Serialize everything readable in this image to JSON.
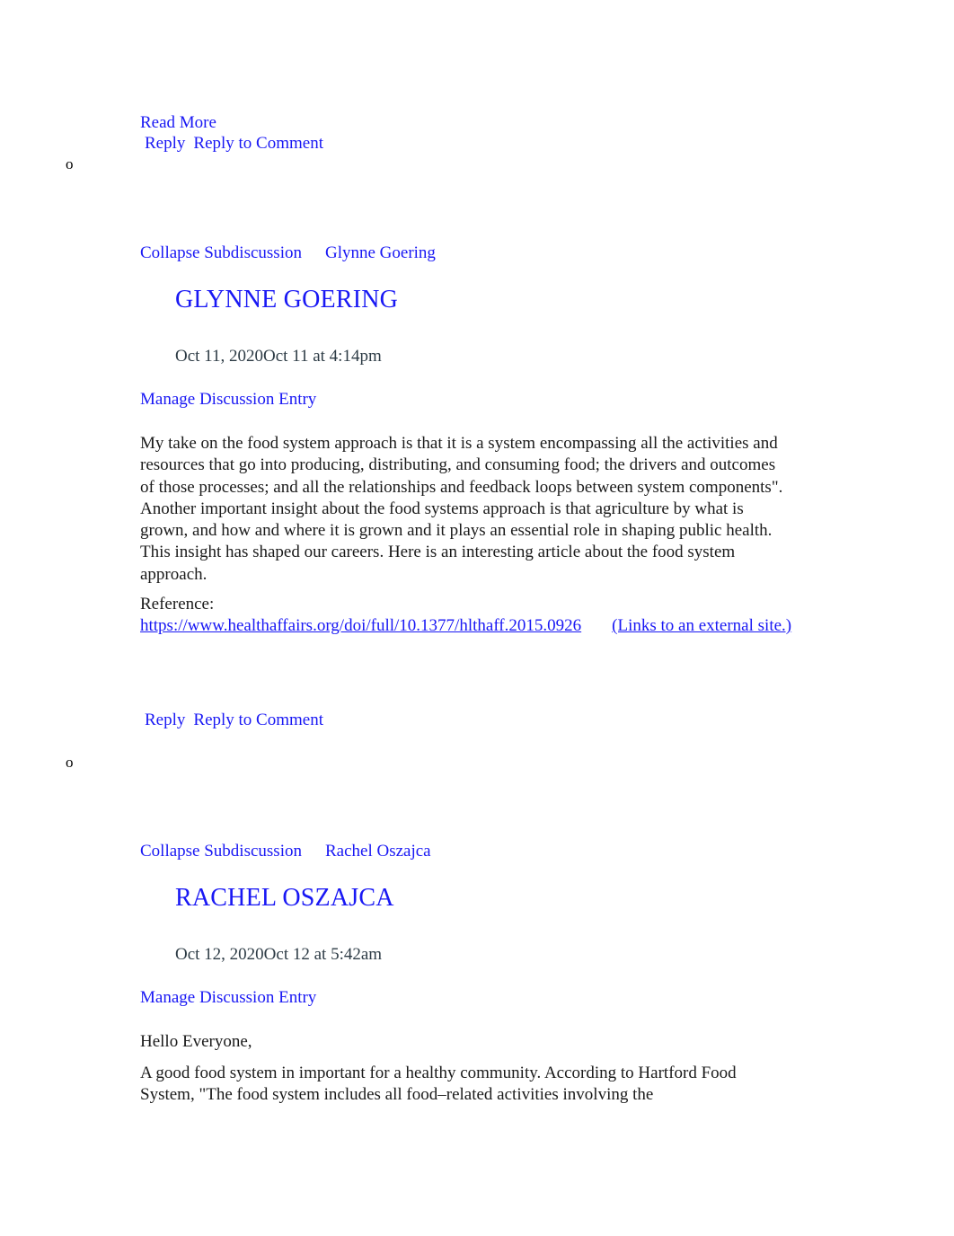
{
  "document": {
    "type": "canvas-discussion-thread",
    "colors": {
      "link": "#1918F4",
      "body_text": "#1a1a1a",
      "date_text": "#2D3B45",
      "background": "#ffffff"
    }
  },
  "top_entry_actions": {
    "read_more_label": "Read More",
    "reply_label": "Reply",
    "reply_to_comment_label": "Reply to Comment"
  },
  "bullets": {
    "first": "o",
    "second": "o"
  },
  "entries": [
    {
      "collapse_label": "Collapse Subdiscussion",
      "collapse_author": "Glynne Goering",
      "author_heading": "GLYNNE GOERING",
      "date": "Oct 11, 2020Oct 11 at 4:14pm",
      "manage_label": "Manage Discussion Entry",
      "body_paragraph": "My take on the food system approach is that it is a system encompassing all the activities and resources that go into producing, distributing, and consuming food; the drivers and outcomes of those processes; and all the relationships and feedback loops between system components\". Another important insight about the food systems approach is that agriculture by what is grown, and how and where it is grown and it plays an essential role in shaping public health. This insight has shaped our careers. Here is an interesting article about the food system approach.",
      "reference_label": "Reference:",
      "reference_url": "https://www.healthaffairs.org/doi/full/10.1377/hlthaff.2015.0926",
      "reference_external_note": "(Links to an external site.)",
      "reply_label": "Reply",
      "reply_to_comment_label": "Reply to Comment"
    },
    {
      "collapse_label": "Collapse Subdiscussion",
      "collapse_author": "Rachel Oszajca",
      "author_heading": "RACHEL OSZAJCA",
      "date": "Oct 12, 2020Oct 12 at 5:42am",
      "manage_label": "Manage Discussion Entry",
      "greeting": "Hello Everyone,",
      "body_paragraph": "A good food system in important for a healthy community. According to Hartford Food System, \"The food system includes all food–related activities involving the"
    }
  ]
}
